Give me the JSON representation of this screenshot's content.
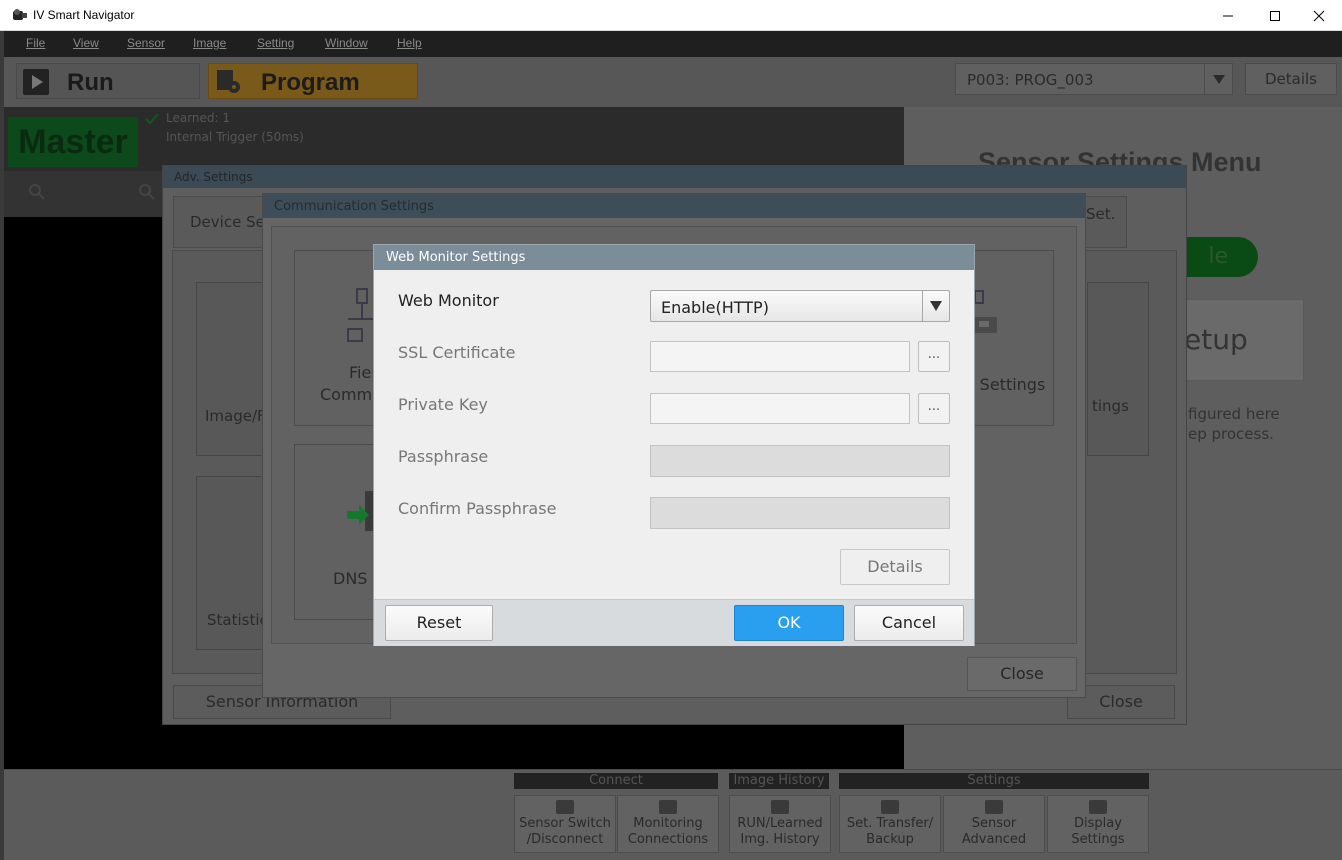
{
  "window": {
    "title": "IV Smart Navigator",
    "controls": [
      "minimize-icon",
      "maximize-icon",
      "close-icon"
    ]
  },
  "menu": {
    "file": "File",
    "view": "View",
    "sensor": "Sensor",
    "image": "Image",
    "setting": "Setting",
    "window": "Window",
    "help": "Help"
  },
  "modes": {
    "run": "Run",
    "program": "Program"
  },
  "program_select": {
    "value": "P003: PROG_003",
    "details": "Details"
  },
  "status": {
    "master": "Master",
    "learned": "Learned: 1",
    "trigger": "Internal Trigger (50ms)"
  },
  "right_panel": {
    "title": "Sensor Settings Menu",
    "green_button": "le",
    "setup": "etup",
    "desc_line1": "figured here",
    "desc_line2": "ep process."
  },
  "bottom": {
    "groups": {
      "connect": "Connect",
      "image_history": "Image History",
      "settings": "Settings"
    },
    "buttons": {
      "sensor_switch": [
        "Sensor Switch",
        "/Disconnect"
      ],
      "monitoring": [
        "Monitoring",
        "Connections"
      ],
      "run_learned": [
        "RUN/Learned",
        "Img. History"
      ],
      "set_transfer": [
        "Set. Transfer/",
        "Backup"
      ],
      "sensor_advanced": [
        "Sensor",
        "Advanced"
      ],
      "display_settings": [
        "Display",
        "Settings"
      ]
    }
  },
  "adv_settings": {
    "title": "Adv. Settings",
    "tab_left": "Device Se",
    "tab_right": "Set.",
    "tile_image": "Image/F",
    "tile_statistics": "Statistic",
    "tile_settings_right": "tings",
    "sensor_information": "Sensor Information",
    "close": "Close"
  },
  "comm_settings": {
    "title": "Communication Settings",
    "tile_field_line1": "Fiel",
    "tile_field_line2": "Comm.",
    "tile_dns": "DNS S",
    "tile_system": "m Settings",
    "close": "Close"
  },
  "web_monitor": {
    "title": "Web Monitor Settings",
    "web_monitor_label": "Web Monitor",
    "web_monitor_value": "Enable(HTTP)",
    "ssl_label": "SSL Certificate",
    "ssl_value": "",
    "private_key_label": "Private Key",
    "private_key_value": "",
    "browse": "...",
    "passphrase_label": "Passphrase",
    "confirm_label": "Confirm Passphrase",
    "details": "Details",
    "reset": "Reset",
    "ok": "OK",
    "cancel": "Cancel"
  },
  "colors": {
    "ok_accent": "#2a9ff0",
    "dialog_title": "#7b8d99",
    "master_green": "#0c4a1c",
    "program_amber": "#7a5a1a"
  }
}
